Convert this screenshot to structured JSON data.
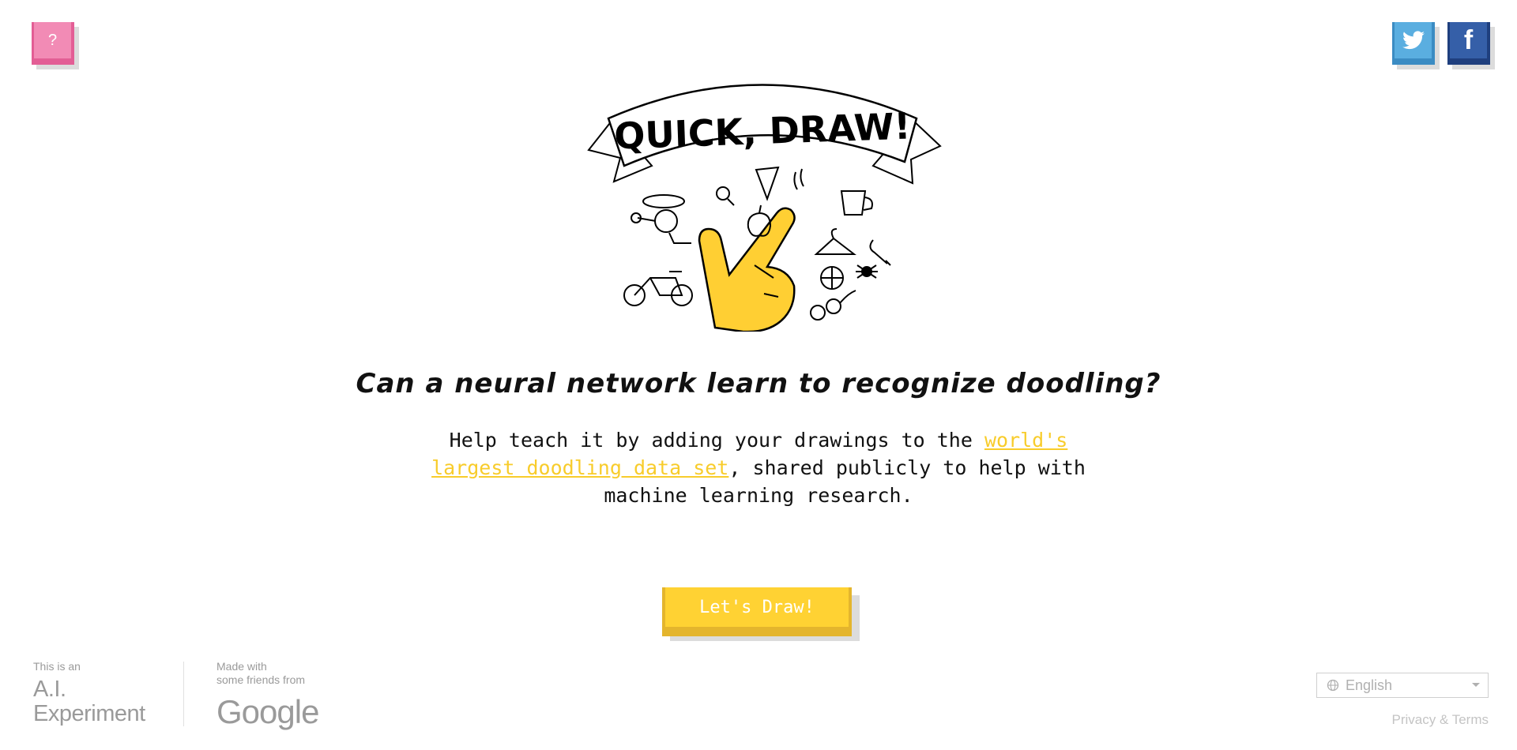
{
  "header": {
    "help_label": "?",
    "share": {
      "twitter_icon": "twitter-bird-icon",
      "facebook_label": "f"
    }
  },
  "hero": {
    "logo_text": "QUICK, DRAW!",
    "headline": "Can a neural network learn to recognize doodling?",
    "description_before": "Help teach it by adding your drawings to the ",
    "description_link": "world's largest doodling data set",
    "description_after": ", shared publicly to help with machine learning research.",
    "cta_label": "Let's Draw!"
  },
  "footer": {
    "ai_small": "This is an",
    "ai_big_line1": "A.I.",
    "ai_big_line2": "Experiment",
    "made_small_line1": "Made with",
    "made_small_line2": "some friends from",
    "google_logo": "Google",
    "language": "English",
    "privacy": "Privacy & Terms"
  },
  "colors": {
    "accent_yellow": "#ffd233",
    "help_pink": "#f28bb5",
    "twitter_blue": "#5aaee0",
    "facebook_blue": "#355fa8"
  }
}
